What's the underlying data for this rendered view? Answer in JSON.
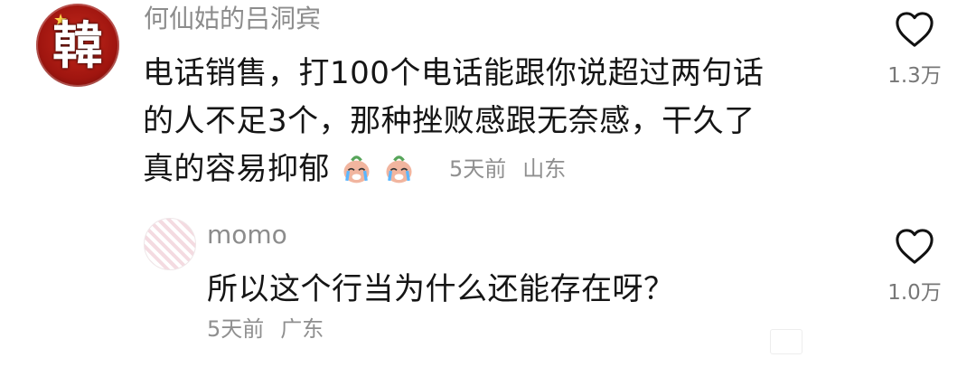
{
  "comments": [
    {
      "author": "何仙姑的吕洞宾",
      "avatar_text": "韓",
      "lines": [
        "电话销售，打100个电话能跟你说超过两句话",
        "的人不足3个，那种挫败感跟无奈感，干久了",
        "真的容易抑郁"
      ],
      "emoji": [
        "crying-face",
        "crying-face"
      ],
      "time": "5天前",
      "location": "山东",
      "likes": "1.3万"
    },
    {
      "author": "momo",
      "lines": [
        "所以这个行当为什么还能存在呀？"
      ],
      "time": "5天前",
      "location": "广东",
      "likes": "1.0万"
    }
  ],
  "colors": {
    "text": "#151515",
    "meta": "#8f8f8f",
    "name": "#8c8c8c",
    "heart": "#111111"
  }
}
